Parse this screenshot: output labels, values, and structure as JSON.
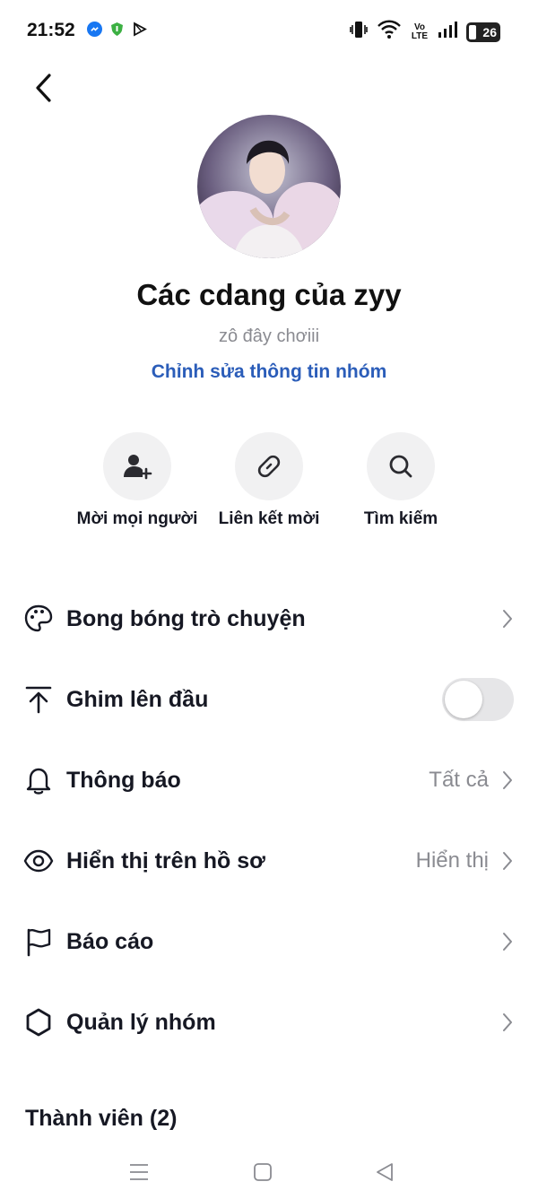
{
  "status": {
    "time": "21:52",
    "battery": "26",
    "network": "Vo LTE"
  },
  "header": {
    "group_name": "Các cdang của zyy",
    "description": "zô đây chơiii",
    "edit_link": "Chỉnh sửa thông tin nhóm"
  },
  "actions": [
    {
      "label": "Mời mọi người",
      "icon": "add-person-icon"
    },
    {
      "label": "Liên kết mời",
      "icon": "link-icon"
    },
    {
      "label": "Tìm kiếm",
      "icon": "search-icon"
    }
  ],
  "settings": [
    {
      "label": "Bong bóng trò chuyện",
      "icon": "palette-icon",
      "value": ""
    },
    {
      "label": "Ghim lên đầu",
      "icon": "pin-top-icon",
      "toggle_on": false
    },
    {
      "label": "Thông báo",
      "icon": "bell-icon",
      "value": "Tất cả"
    },
    {
      "label": "Hiển thị trên hồ sơ",
      "icon": "eye-icon",
      "value": "Hiển thị"
    },
    {
      "label": "Báo cáo",
      "icon": "flag-icon",
      "value": ""
    },
    {
      "label": "Quản lý nhóm",
      "icon": "gear-icon",
      "value": ""
    }
  ],
  "members": {
    "title": "Thành viên (2)"
  },
  "colors": {
    "link": "#2b5db9",
    "text": "#161823",
    "muted": "#8a8b91",
    "circle_bg": "#f1f1f2"
  }
}
